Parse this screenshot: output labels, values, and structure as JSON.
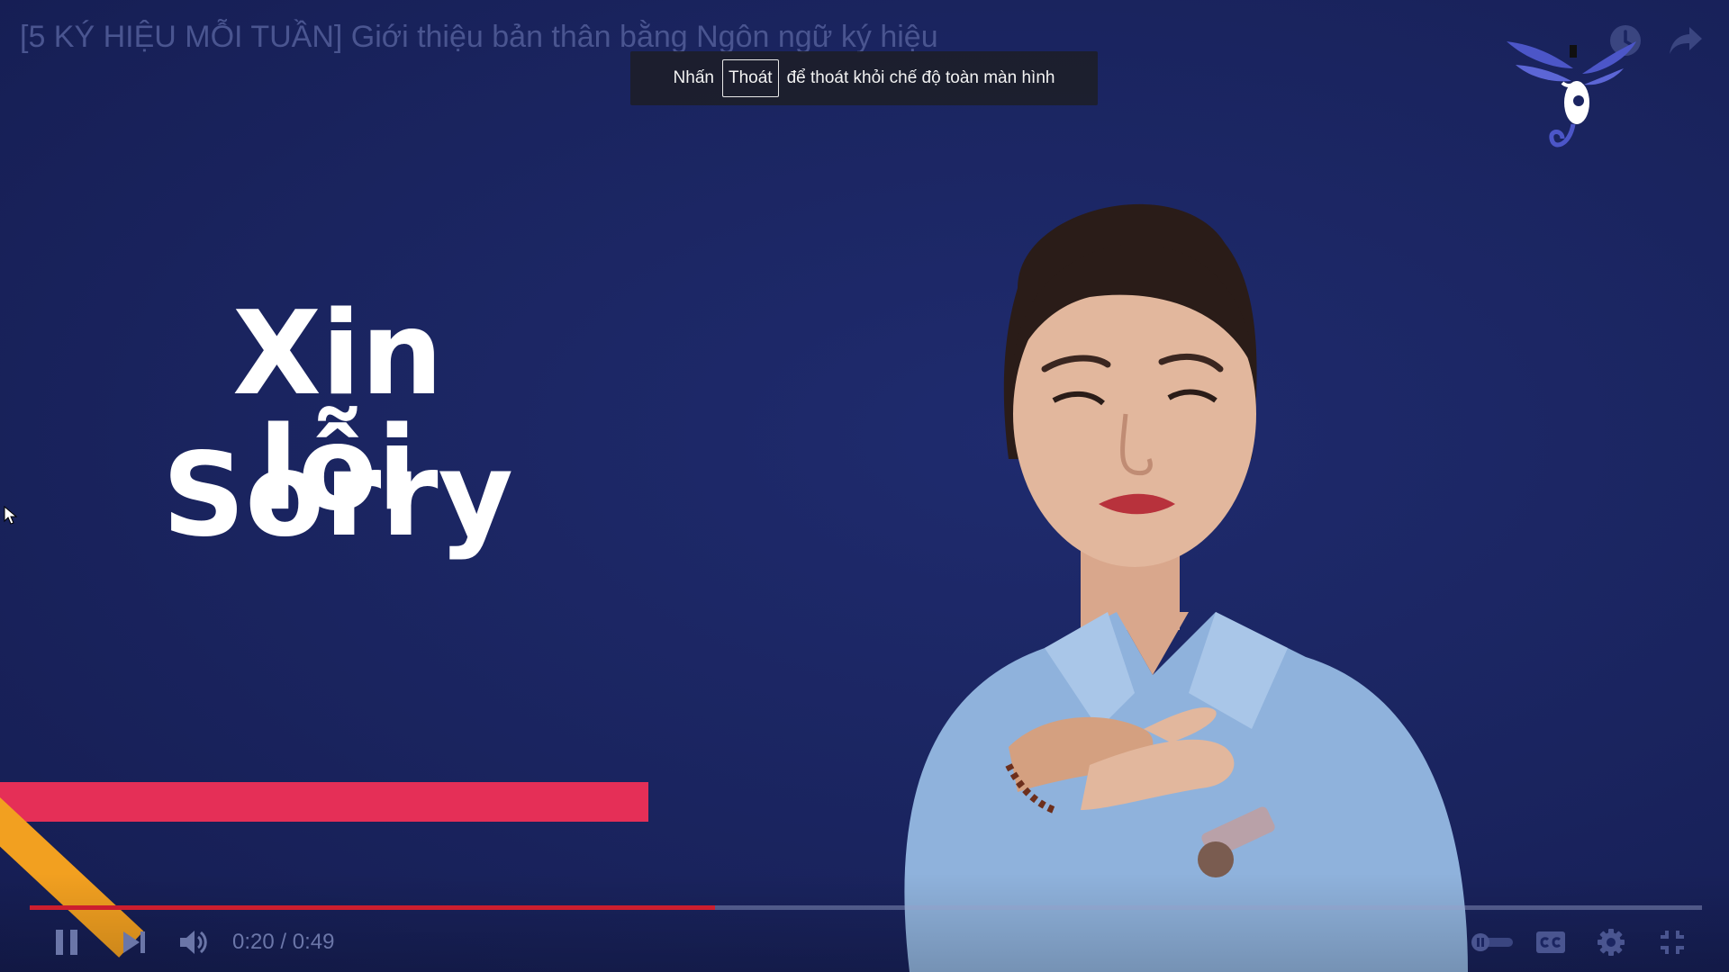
{
  "video": {
    "title": "[5 KÝ HIỆU MỖI TUẦN] Giới thiệu bản thân bằng Ngôn ngữ ký hiệu"
  },
  "fullscreen_toast": {
    "prefix": "Nhấn",
    "key": "Thoát",
    "suffix": "để thoát khỏi chế độ toàn màn hình"
  },
  "slide": {
    "line1": "Xin lỗi",
    "line2": "Sorry"
  },
  "player": {
    "current_time": "0:20",
    "separator": " / ",
    "duration": "0:49",
    "progress_fraction": 0.41,
    "colors": {
      "played": "#cc1e2e",
      "background": "#1b2561",
      "red_stripe": "#e52f57",
      "orange_stripe": "#f2a020"
    }
  },
  "icons": {
    "top_right": [
      "watch-later-icon",
      "share-icon"
    ],
    "controls_left": [
      "pause-icon",
      "next-icon",
      "volume-icon"
    ],
    "controls_right": [
      "autoplay-toggle-icon",
      "captions-icon",
      "settings-icon",
      "exit-fullscreen-icon"
    ]
  }
}
